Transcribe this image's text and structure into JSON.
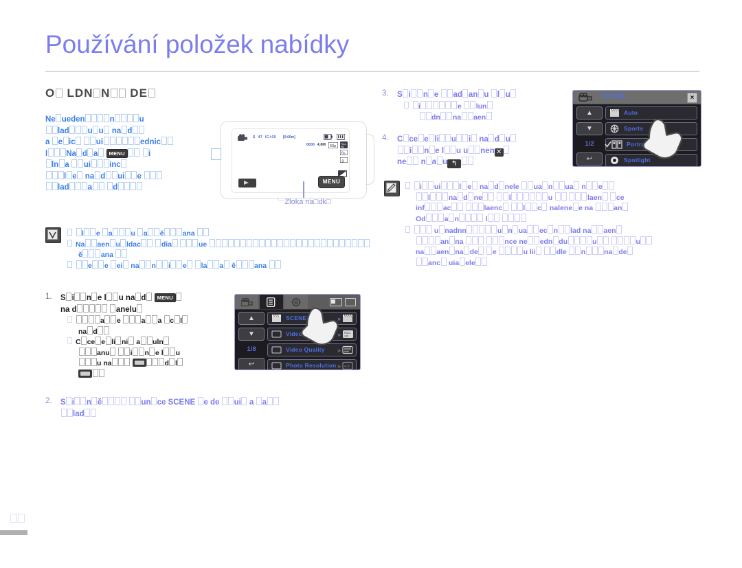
{
  "document": {
    "title": "Používání položek nabídky",
    "section_heading": "O□ LDN□N□□DE□",
    "folio": "□□"
  },
  "intro": {
    "lines": [
      "Ne□ueden□□□□n□□□□u",
      "□□lad□□□u□u□ na□d□□",
      "a □e□ic□ □□ui□□□□□□ednic□□",
      "l□□□Na□d□a□ [MENU] □□ □i",
      "□ln□a □□ui□□□inc□",
      "□□□l□e□ na□d□□ui□□e □□□",
      "□□lad□□□a□□ □d□□□□"
    ],
    "menu_key_label": "MENU"
  },
  "tip_box": {
    "icon": "check-box-icon",
    "items": [
      "□l□□e □a□□u □a□□ě□□□ana □□",
      "Na□□aen□u□ldac□□ □dia□ □□□ue □□□□□□□□□□□□□□□□□□□□□□□□□□",
      "ě□□□ana □□",
      "□□□e□□e □ei□ na□□n□□i□□e□ □la□□a□ ě□□□ana □□"
    ]
  },
  "illustration": {
    "caption": "Zloka na□dk□",
    "menu_button_label": "MENU",
    "lcd_labels": [
      "4.8M",
      "□□□□"
    ]
  },
  "steps": [
    {
      "number": "1.",
      "color": "dark",
      "lines": [
        "S□i□□n□e l□□u na□d□ [MENU]□",
        "na d□□□□□ □anelu□"
      ],
      "subitems": [
        [
          "□□□□a□□e □□□a□□a □c□l□",
          "na□d□□"
        ],
        [
          "C□ce□e□li□ni□ a□□uln□",
          "□□□anu□ □□i□□n□e l□□u",
          "□□□u na□□□ [IMG] □□□d□l□",
          "[IMG]□□"
        ]
      ]
    },
    {
      "number": "2.",
      "color": "violet",
      "lines": [
        "S□i□□n□ě□□□□ □□un□ce SCENE □e de □□ui□ a □a□□",
        "□□lad□□"
      ],
      "subitems": []
    },
    {
      "number": "3.",
      "color": "violet",
      "lines": [
        "S□i□□n□e □□ad□an□u □l□u□"
      ],
      "subitems": [
        [
          "□i□□□□□e □□lun□",
          "□□dn□□na□□aen□"
        ]
      ]
    },
    {
      "number": "4.",
      "color": "violet",
      "lines": [
        "C□ce□e□li□□u□□i□ na□d□u□",
        "□□i□□n□e l□□u u□□nen [X]□",
        "ne□□ n□a□u [BACK]□□"
      ],
      "subitems": []
    }
  ],
  "note_box": {
    "icon": "pencil-note-icon",
    "items": [
      [
        "□i□□ui□□□l□e□ na□d□nele □□ua□n□□ua□ n□□e□□",
        "□□l□□□na□d□ne□□ □□□l□□□□□□u □□ □□□laen□ □ce",
        "inf□□□ac□□ □□□laenc□ □□l□□c□ nalene□e na □□□an□",
        "Od□□□a□n□□□□ l□□ □□□□"
      ],
      [
        "□□□ u□nadnn□□□□□u□n□ua□□ec□n□□lad na□□aen□",
        "□□□□□an□na □□□ □□□nce ne□□edn□du□□□□u□□ □□□□u□□",
        "na□□aen□na□de□ □e □□□□u lii□ □□dle □□n□□□na□de□",
        "□□anc□ uia□ele□□"
      ]
    ]
  },
  "scene_panel": {
    "title": "SCENE",
    "close_label": "×",
    "page_indicator": "1/2",
    "up_label": "▲",
    "down_label": "▼",
    "back_label": "↩",
    "rows": [
      {
        "label": "Auto",
        "icon": "clapperboard-icon",
        "selected": false
      },
      {
        "label": "Sports",
        "icon": "sports-icon",
        "selected": false
      },
      {
        "label": "Portrait",
        "icon": "portrait-icon",
        "selected": true
      },
      {
        "label": "Spotlight",
        "icon": "spotlight-icon",
        "selected": false
      }
    ]
  },
  "menu_panel": {
    "page_indicator": "1/8",
    "up_label": "▲",
    "down_label": "▼",
    "back_label": "↩",
    "tabs": [
      {
        "name": "tab-camera",
        "selected": false
      },
      {
        "name": "tab-menu",
        "selected": true
      },
      {
        "name": "tab-settings",
        "selected": false
      }
    ],
    "rows": [
      {
        "label": "SCENE",
        "icon": "clapperboard-icon",
        "chevron": "»"
      },
      {
        "label": "Video Resolution",
        "icon": "fullhd-icon",
        "chevron": "»"
      },
      {
        "label": "Video Quality",
        "icon": "quality-icon",
        "chevron": "»"
      },
      {
        "label": "Photo Resolution",
        "icon": "photo-icon",
        "chevron": "»"
      }
    ]
  }
}
